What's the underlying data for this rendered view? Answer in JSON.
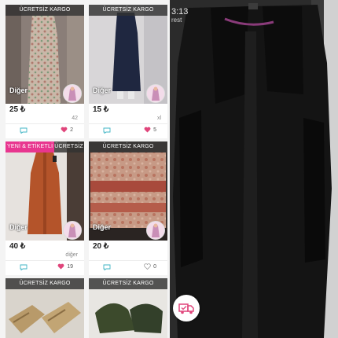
{
  "listings": [
    {
      "ribbon": "ÜCRETSİZ KARGO",
      "category": "Diğer",
      "price": "25 ₺",
      "size": "42",
      "likes": "2",
      "liked": true
    },
    {
      "ribbon": "ÜCRETSİZ KARGO",
      "category": "Diğer",
      "price": "15 ₺",
      "size": "xl",
      "likes": "5",
      "liked": true
    },
    {
      "badge": "YENİ & ETİKETLİ",
      "ribbon": "ÜCRETSİZ KARGO",
      "category": "Diğer",
      "price": "40 ₺",
      "size": "diğer",
      "likes": "19",
      "liked": true
    },
    {
      "ribbon": "ÜCRETSİZ KARGO",
      "category": "Diğer",
      "price": "20 ₺",
      "size": "",
      "likes": "0",
      "liked": false
    },
    {
      "ribbon": "ÜCRETSİZ KARGO"
    },
    {
      "ribbon": "ÜCRETSİZ KARGO"
    }
  ],
  "status": {
    "time": "3:13",
    "carrier": "rest"
  },
  "colors": {
    "badge_pink": "#e8368f",
    "ribbon_dark": "#323232",
    "heart_pink": "#e0457b",
    "comment_teal": "#3fb4c4"
  },
  "icons": {
    "comment": "comment-bubble-icon",
    "like": "heart-icon",
    "avatar": "seller-avatar",
    "shipping": "free-shipping-truck-icon"
  }
}
